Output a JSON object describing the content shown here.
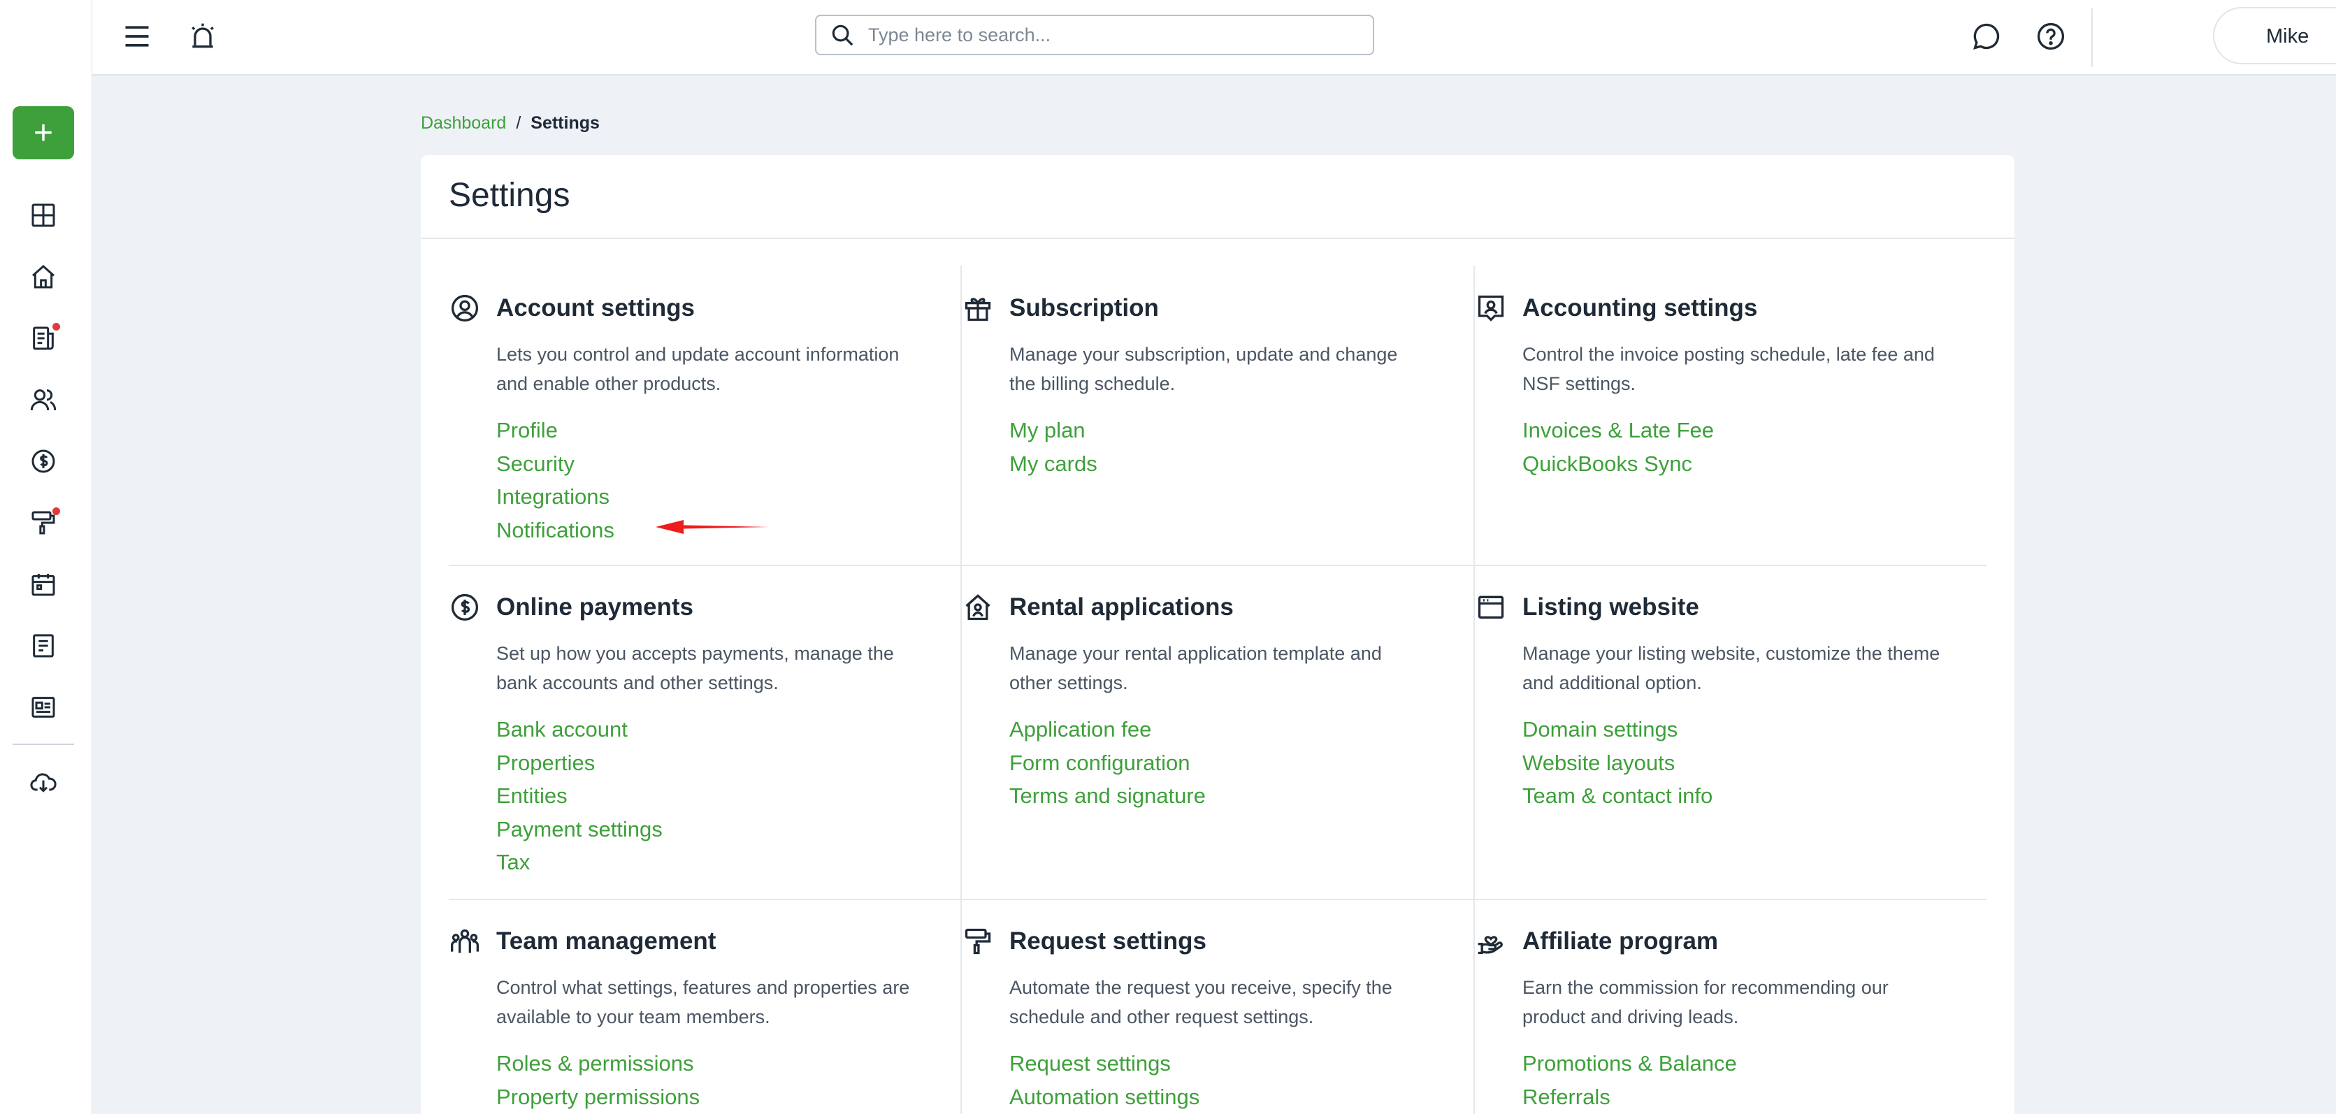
{
  "topbar": {
    "search_placeholder": "Type here to search...",
    "user_name": "Mike"
  },
  "breadcrumb": {
    "root": "Dashboard",
    "separator": "/",
    "current": "Settings"
  },
  "page": {
    "title": "Settings"
  },
  "colors": {
    "accent": "#3ea03b",
    "notification_dot": "#e03a3a",
    "annotation_arrow": "#ee1c1c"
  },
  "sections": [
    {
      "title": "Account settings",
      "icon": "user-circle-icon",
      "description": "Lets you control and update account information and enable other products.",
      "links": [
        "Profile",
        "Security",
        "Integrations",
        "Notifications"
      ]
    },
    {
      "title": "Subscription",
      "icon": "gift-icon",
      "description": "Manage your subscription, update and change the billing schedule.",
      "links": [
        "My plan",
        "My cards"
      ]
    },
    {
      "title": "Accounting settings",
      "icon": "receipt-pin-icon",
      "description": "Control the invoice posting schedule, late fee and NSF settings.",
      "links": [
        "Invoices & Late Fee",
        "QuickBooks Sync"
      ]
    },
    {
      "title": "Online payments",
      "icon": "dollar-circle-icon",
      "description": "Set up how you accepts payments, manage the bank accounts and other settings.",
      "links": [
        "Bank account",
        "Properties",
        "Entities",
        "Payment settings",
        "Tax"
      ]
    },
    {
      "title": "Rental applications",
      "icon": "house-user-icon",
      "description": "Manage your rental application template and other settings.",
      "links": [
        "Application fee",
        "Form configuration",
        "Terms and signature"
      ]
    },
    {
      "title": "Listing website",
      "icon": "browser-window-icon",
      "description": "Manage your listing website, customize the theme and additional option.",
      "links": [
        "Domain settings",
        "Website layouts",
        "Team & contact info"
      ]
    },
    {
      "title": "Team management",
      "icon": "team-icon",
      "description": "Control what settings, features and properties are available to your team members.",
      "links": [
        "Roles & permissions",
        "Property permissions"
      ]
    },
    {
      "title": "Request settings",
      "icon": "paint-roller-icon",
      "description": "Automate the request you receive, specify the schedule and other request settings.",
      "links": [
        "Request settings",
        "Automation settings"
      ]
    },
    {
      "title": "Affiliate program",
      "icon": "hand-heart-icon",
      "description": "Earn the commission for recommending our product and driving leads.",
      "links": [
        "Promotions & Balance",
        "Referrals"
      ]
    }
  ]
}
